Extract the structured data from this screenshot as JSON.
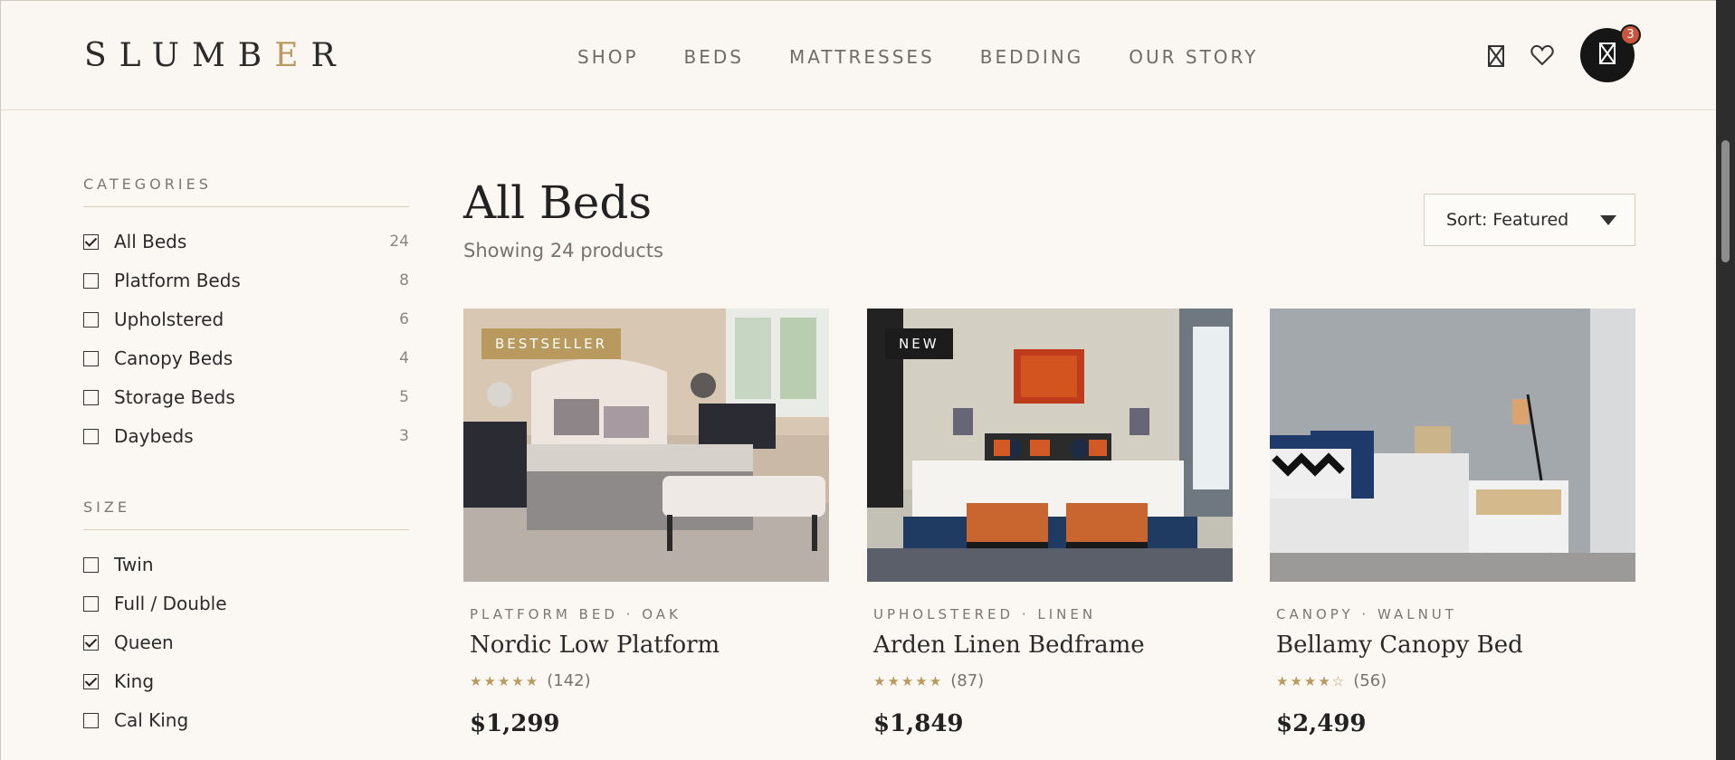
{
  "header": {
    "logo_pre": "SLUMB",
    "logo_accent": "E",
    "logo_post": "R",
    "nav": [
      "SHOP",
      "BEDS",
      "MATTRESSES",
      "BEDDING",
      "OUR STORY"
    ],
    "cart_count": "3",
    "icons": [
      "cart-outline-icon",
      "heart-icon",
      "cart-icon"
    ]
  },
  "sidebar": {
    "categories_title": "CATEGORIES",
    "categories": [
      {
        "label": "All Beds",
        "count": "24",
        "checked": true
      },
      {
        "label": "Platform Beds",
        "count": "8",
        "checked": false
      },
      {
        "label": "Upholstered",
        "count": "6",
        "checked": false
      },
      {
        "label": "Canopy Beds",
        "count": "4",
        "checked": false
      },
      {
        "label": "Storage Beds",
        "count": "5",
        "checked": false
      },
      {
        "label": "Daybeds",
        "count": "3",
        "checked": false
      }
    ],
    "size_title": "SIZE",
    "sizes": [
      {
        "label": "Twin",
        "checked": false
      },
      {
        "label": "Full / Double",
        "checked": false
      },
      {
        "label": "Queen",
        "checked": true
      },
      {
        "label": "King",
        "checked": true
      },
      {
        "label": "Cal King",
        "checked": false
      }
    ]
  },
  "main": {
    "title": "All Beds",
    "subtitle": "Showing 24 products",
    "sort_label": "Sort: Featured"
  },
  "products": [
    {
      "badge": "BESTSELLER",
      "meta": "PLATFORM BED · OAK",
      "name": "Nordic Low Platform",
      "stars": "★★★★★",
      "reviews": "(142)",
      "price": "$1,299"
    },
    {
      "badge": "NEW",
      "meta": "UPHOLSTERED · LINEN",
      "name": "Arden Linen Bedframe",
      "stars": "★★★★★",
      "reviews": "(87)",
      "price": "$1,849"
    },
    {
      "badge": "",
      "meta": "CANOPY · WALNUT",
      "name": "Bellamy Canopy Bed",
      "stars": "★★★★☆",
      "reviews": "(56)",
      "price": "$2,499"
    }
  ],
  "colors": {
    "background": "#fbf8f4",
    "accent_gold": "#b89a5e",
    "badge_new": "#1c1c1c",
    "cart_badge": "#c8553d",
    "dark": "#161616"
  }
}
